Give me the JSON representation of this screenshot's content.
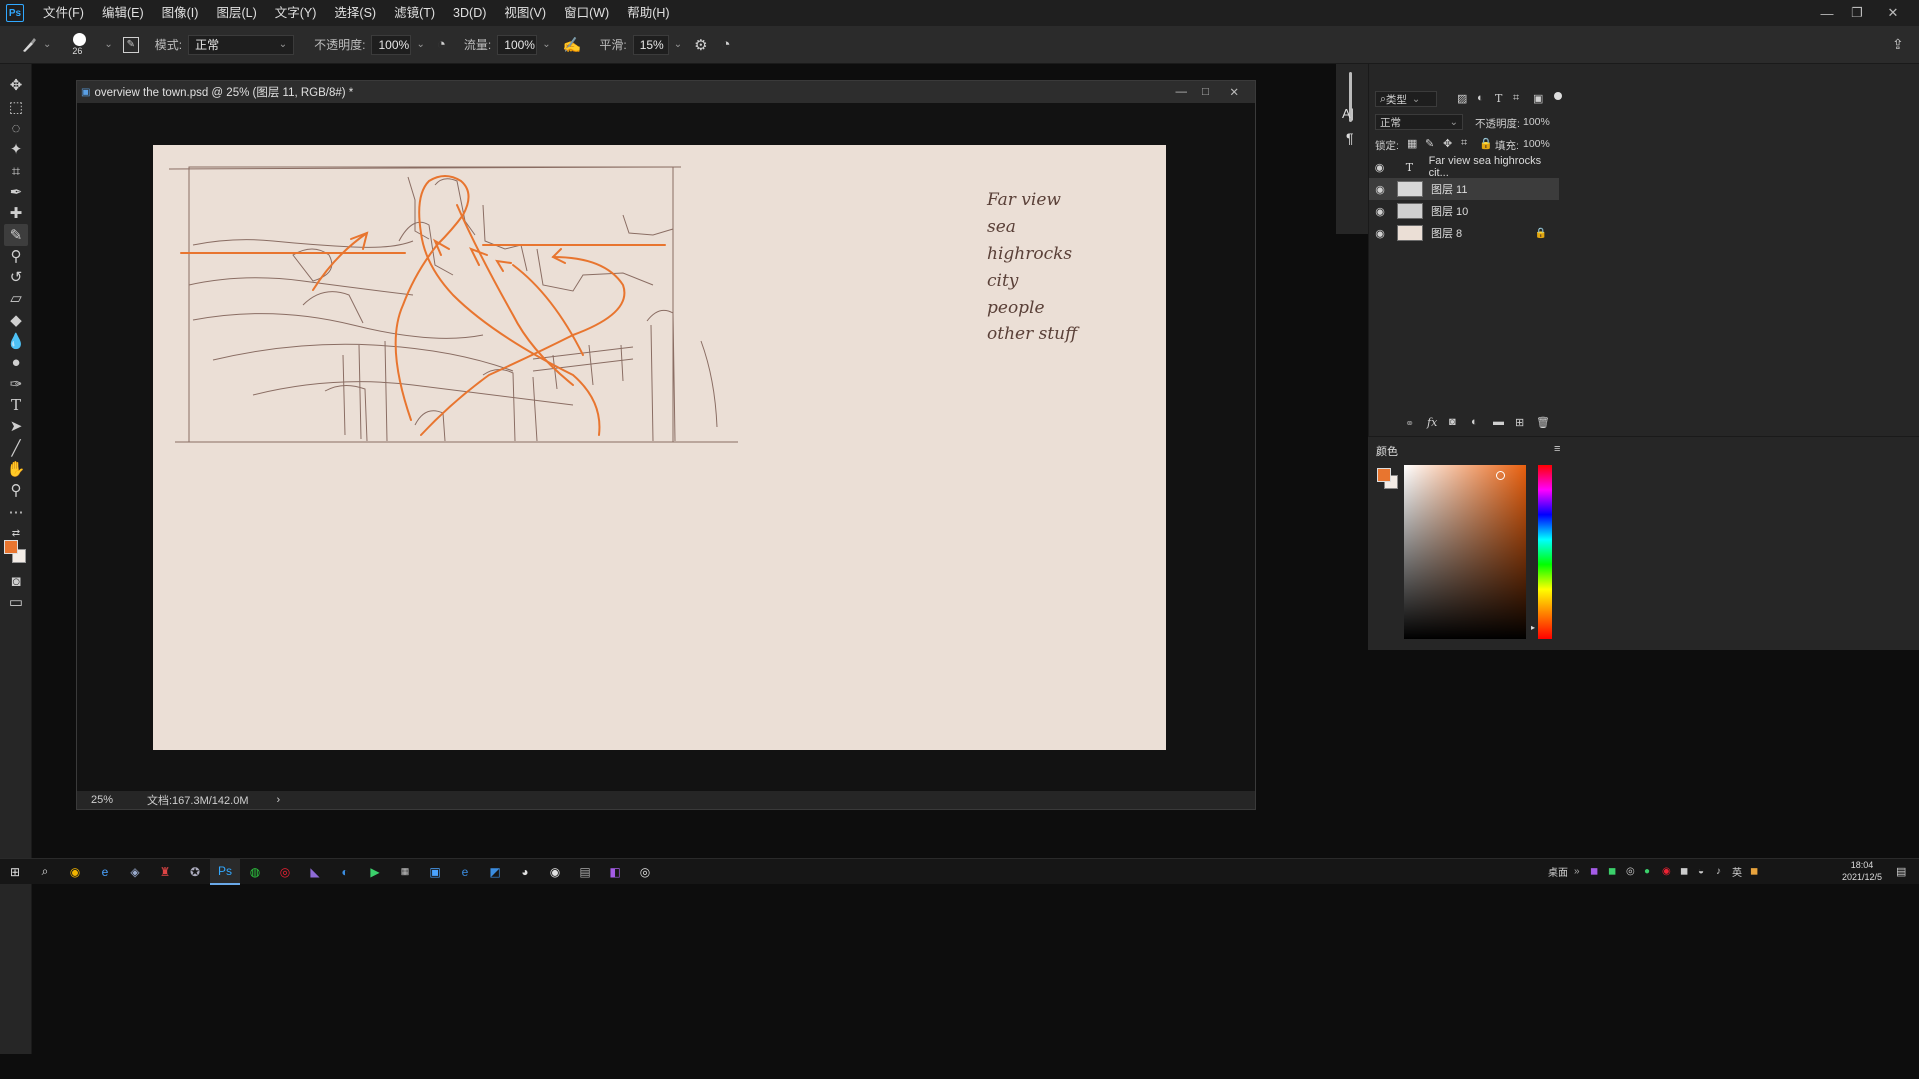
{
  "app": {
    "logo_text": "Ps"
  },
  "menu": [
    "文件(F)",
    "编辑(E)",
    "图像(I)",
    "图层(L)",
    "文字(Y)",
    "选择(S)",
    "滤镜(T)",
    "3D(D)",
    "视图(V)",
    "窗口(W)",
    "帮助(H)"
  ],
  "options": {
    "brush_size": "26",
    "mode_label": "模式:",
    "mode_value": "正常",
    "opacity_label": "不透明度:",
    "opacity_value": "100%",
    "flow_label": "流量:",
    "flow_value": "100%",
    "smooth_label": "平滑:",
    "smooth_value": "15%"
  },
  "document": {
    "title": "overview the town.psd @ 25% (图层 11, RGB/8#) *",
    "zoom": "25%",
    "doc_size": "文档:167.3M/142.0M",
    "status_arrow": "›",
    "notes": [
      "Far view",
      "sea",
      "highrocks",
      "city",
      "people",
      "other stuff"
    ]
  },
  "layers_panel": {
    "filter_label": "类型",
    "blend_mode": "正常",
    "opacity_label": "不透明度:",
    "opacity_value": "100%",
    "lock_label": "锁定:",
    "fill_label": "填充:",
    "fill_value": "100%",
    "layers": [
      {
        "name": "Far view sea highrocks cit...",
        "type": "text"
      },
      {
        "name": "图层 11",
        "type": "pixel",
        "selected": true
      },
      {
        "name": "图层 10",
        "type": "pixel"
      },
      {
        "name": "图层 8",
        "type": "pixel",
        "locked": true
      }
    ],
    "footer_fx": "fx"
  },
  "color_panel": {
    "title": "颜色",
    "foreground": "#e8752f",
    "background": "#f3ece6"
  },
  "side_strip": {
    "char_icon": "A|",
    "para_icon": "¶"
  },
  "taskbar": {
    "desktop_label": "桌面",
    "ime": "英",
    "time": "18:04",
    "date": "2021/12/5"
  },
  "colors": {
    "accent_orange": "#e8752f",
    "canvas": "#ebdfd6",
    "sketch_line": "#7a5a50"
  }
}
